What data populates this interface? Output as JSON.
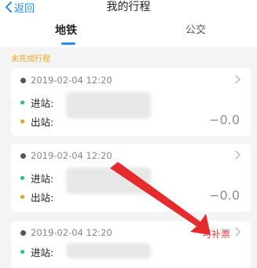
{
  "header": {
    "back_label": "返回",
    "title": "我的行程"
  },
  "tabs": [
    {
      "label": "地铁",
      "active": true
    },
    {
      "label": "公交",
      "active": false
    }
  ],
  "section_label": "未完成行程",
  "trips": [
    {
      "datetime": "2019-02-04  12:20",
      "entry_label": "进站:",
      "exit_label": "出站:",
      "amount": "−0.0"
    },
    {
      "datetime": "2019-02-04  12:20",
      "entry_label": "进站:",
      "exit_label": "出站:",
      "amount": "−0.0"
    },
    {
      "datetime": "2019-02-04  12:20",
      "entry_label": "进站:",
      "exit_label": "出站:",
      "refill_label": "可补票"
    }
  ],
  "colors": {
    "accent": "#2a8cf0",
    "section_label": "#f5a623",
    "entry_dot": "#27c27a",
    "exit_dot": "#f59a23",
    "refill": "#e64b4b",
    "annotation_arrow": "#e52b2b"
  }
}
